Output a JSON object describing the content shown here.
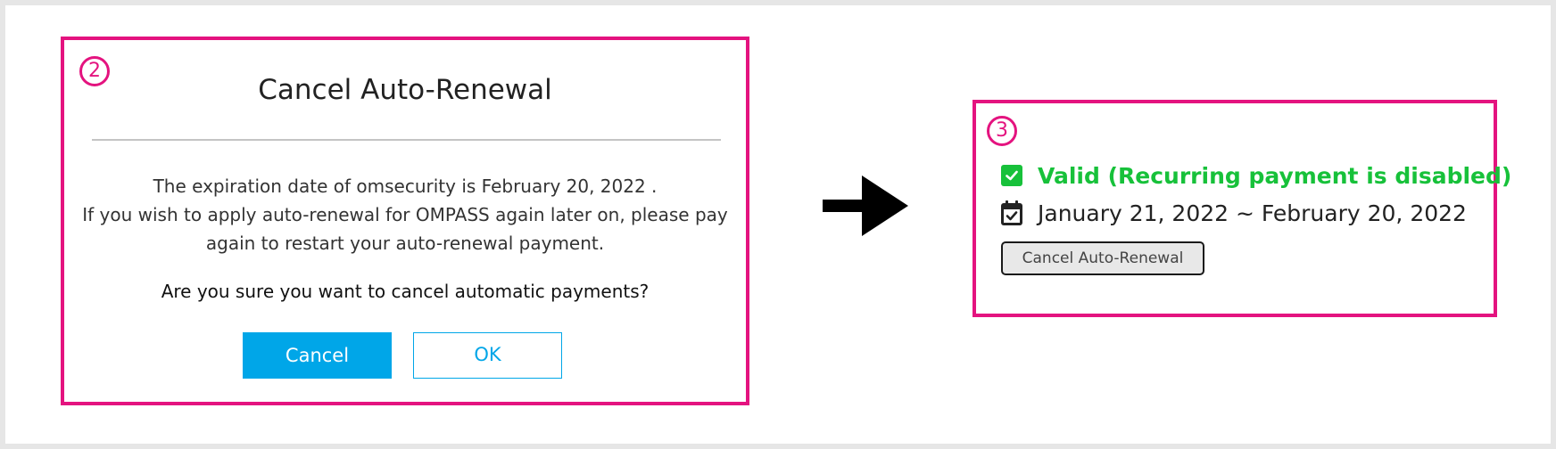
{
  "step2": {
    "badge": "2",
    "dialog": {
      "title": "Cancel Auto-Renewal",
      "message_line1": "The expiration date of omsecurity is February 20, 2022 .",
      "message_line2": "If you wish to apply auto-renewal for OMPASS again later on, please pay",
      "message_line3": "again to restart your auto-renewal payment.",
      "question": "Are you sure you want to cancel automatic payments?",
      "cancel_label": "Cancel",
      "ok_label": "OK"
    }
  },
  "arrow": {
    "icon": "right-arrow-icon"
  },
  "step3": {
    "badge": "3",
    "status": {
      "icon": "check-square-icon",
      "text": "Valid (Recurring payment is disabled)",
      "color": "#17c13a"
    },
    "period": {
      "icon": "calendar-check-icon",
      "text": "January 21, 2022 ~ February 20, 2022"
    },
    "cancel_renewal_label": "Cancel Auto-Renewal"
  },
  "colors": {
    "highlight_border": "#e4137f",
    "primary_button": "#00a6e8",
    "status_green": "#17c13a"
  }
}
